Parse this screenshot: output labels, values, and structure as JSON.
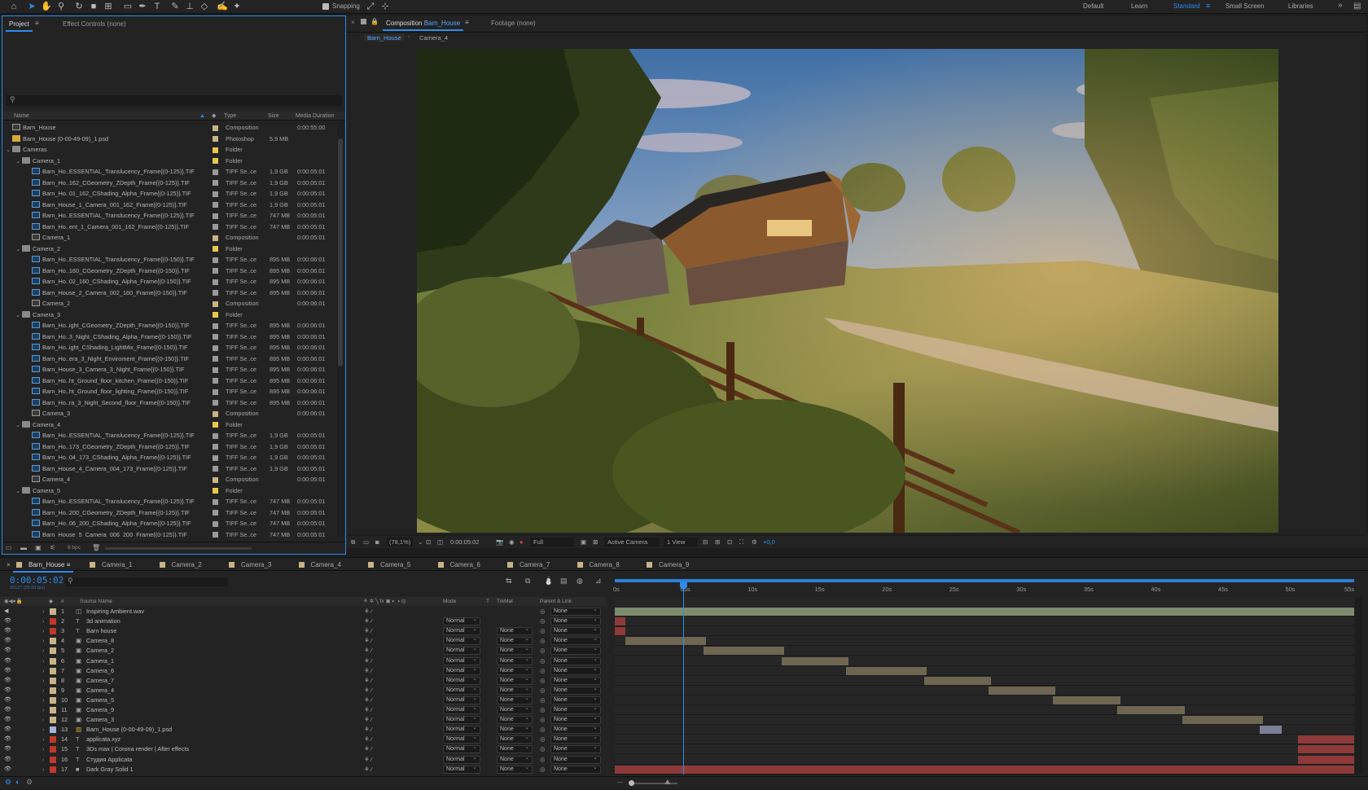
{
  "toolbar": {
    "snapping_label": "Snapping",
    "workspaces": [
      "Default",
      "Learn",
      "Standard",
      "Small Screen",
      "Libraries"
    ],
    "active_workspace": "Standard"
  },
  "project_panel": {
    "tab_project": "Project",
    "tab_effect_controls": "Effect Controls (none)",
    "columns": {
      "name": "Name",
      "type": "Type",
      "size": "Size",
      "duration": "Media Duration"
    },
    "bpc": "8 bpc",
    "items": [
      {
        "name": "Barn_House",
        "type": "Composition",
        "size": "",
        "dur": "0:00:55:00",
        "icon": "comp",
        "indent": 0,
        "tw": "",
        "color": "#c8b48a"
      },
      {
        "name": "Barn_House (0-00-49-09)_1.psd",
        "type": "Photoshop",
        "size": "5,9 MB",
        "dur": "",
        "icon": "psd",
        "indent": 0,
        "tw": "",
        "color": "#c8b48a"
      },
      {
        "name": "Cameras",
        "type": "Folder",
        "size": "",
        "dur": "",
        "icon": "folder",
        "indent": 0,
        "tw": "⌄",
        "color": "#e8c84a"
      },
      {
        "name": "Camera_1",
        "type": "Folder",
        "size": "",
        "dur": "",
        "icon": "folder",
        "indent": 1,
        "tw": "⌄",
        "color": "#e8c84a"
      },
      {
        "name": "Barn_Ho..ESSENTIAL_Translucency_Frame{(0-125)}.TIF",
        "type": "TIFF Se..ce",
        "size": "1,9 GB",
        "dur": "0:00:05:01",
        "icon": "tiff",
        "indent": 2,
        "tw": "",
        "color": "#9a9a9a"
      },
      {
        "name": "Barn_Ho..162_CGeometry_ZDepth_Frame{(0-125)}.TIF",
        "type": "TIFF Se..ce",
        "size": "1,9 GB",
        "dur": "0:00:05:01",
        "icon": "tiff",
        "indent": 2,
        "tw": "",
        "color": "#9a9a9a"
      },
      {
        "name": "Barn_Ho..01_162_CShading_Alpha_Frame{(0-125)}.TIF",
        "type": "TIFF Se..ce",
        "size": "1,9 GB",
        "dur": "0:00:05:01",
        "icon": "tiff",
        "indent": 2,
        "tw": "",
        "color": "#9a9a9a"
      },
      {
        "name": "Barn_House_1_Camera_001_162_Frame{(0-125)}.TIF",
        "type": "TIFF Se..ce",
        "size": "1,9 GB",
        "dur": "0:00:05:01",
        "icon": "tiff",
        "indent": 2,
        "tw": "",
        "color": "#9a9a9a"
      },
      {
        "name": "Barn_Ho..ESSENTIAL_Translucency_Frame{(0-125)}.TIF",
        "type": "TIFF Se..ce",
        "size": "747 MB",
        "dur": "0:00:05:01",
        "icon": "tiff",
        "indent": 2,
        "tw": "",
        "color": "#9a9a9a"
      },
      {
        "name": "Barn_Ho..ent_1_Camera_001_162_Frame{(0-125)}.TIF",
        "type": "TIFF Se..ce",
        "size": "747 MB",
        "dur": "0:00:05:01",
        "icon": "tiff",
        "indent": 2,
        "tw": "",
        "color": "#9a9a9a"
      },
      {
        "name": "Camera_1",
        "type": "Composition",
        "size": "",
        "dur": "0:00:05:01",
        "icon": "comp",
        "indent": 2,
        "tw": "",
        "color": "#c8b48a"
      },
      {
        "name": "Camera_2",
        "type": "Folder",
        "size": "",
        "dur": "",
        "icon": "folder",
        "indent": 1,
        "tw": "⌄",
        "color": "#e8c84a"
      },
      {
        "name": "Barn_Ho..ESSENTIAL_Translucency_Frame{(0-150)}.TIF",
        "type": "TIFF Se..ce",
        "size": "895 MB",
        "dur": "0:00:06:01",
        "icon": "tiff",
        "indent": 2,
        "tw": "",
        "color": "#9a9a9a"
      },
      {
        "name": "Barn_Ho..160_CGeometry_ZDepth_Frame{(0-150)}.TIF",
        "type": "TIFF Se..ce",
        "size": "895 MB",
        "dur": "0:00:06:01",
        "icon": "tiff",
        "indent": 2,
        "tw": "",
        "color": "#9a9a9a"
      },
      {
        "name": "Barn_Ho..02_160_CShading_Alpha_Frame{(0-150)}.TIF",
        "type": "TIFF Se..ce",
        "size": "895 MB",
        "dur": "0:00:06:01",
        "icon": "tiff",
        "indent": 2,
        "tw": "",
        "color": "#9a9a9a"
      },
      {
        "name": "Barn_House_2_Camera_002_160_Frame{(0-150)}.TIF",
        "type": "TIFF Se..ce",
        "size": "895 MB",
        "dur": "0:00:06:01",
        "icon": "tiff",
        "indent": 2,
        "tw": "",
        "color": "#9a9a9a"
      },
      {
        "name": "Camera_2",
        "type": "Composition",
        "size": "",
        "dur": "0:00:06:01",
        "icon": "comp",
        "indent": 2,
        "tw": "",
        "color": "#c8b48a"
      },
      {
        "name": "Camera_3",
        "type": "Folder",
        "size": "",
        "dur": "",
        "icon": "folder",
        "indent": 1,
        "tw": "⌄",
        "color": "#e8c84a"
      },
      {
        "name": "Barn_Ho..ight_CGeometry_ZDepth_Frame{(0-150)}.TIF",
        "type": "TIFF Se..ce",
        "size": "895 MB",
        "dur": "0:00:06:01",
        "icon": "tiff",
        "indent": 2,
        "tw": "",
        "color": "#9a9a9a"
      },
      {
        "name": "Barn_Ho..3_Night_CShading_Alpha_Frame{(0-150)}.TIF",
        "type": "TIFF Se..ce",
        "size": "895 MB",
        "dur": "0:00:06:01",
        "icon": "tiff",
        "indent": 2,
        "tw": "",
        "color": "#9a9a9a"
      },
      {
        "name": "Barn_Ho..ight_CShading_LightMix_Frame{(0-150)}.TIF",
        "type": "TIFF Se..ce",
        "size": "895 MB",
        "dur": "0:00:06:01",
        "icon": "tiff",
        "indent": 2,
        "tw": "",
        "color": "#9a9a9a"
      },
      {
        "name": "Barn_Ho..era_3_Night_Enviroment_Frame{(0-150)}.TIF",
        "type": "TIFF Se..ce",
        "size": "895 MB",
        "dur": "0:00:06:01",
        "icon": "tiff",
        "indent": 2,
        "tw": "",
        "color": "#9a9a9a"
      },
      {
        "name": "Barn_House_3_Camera_3_Night_Frame{(0-150)}.TIF",
        "type": "TIFF Se..ce",
        "size": "895 MB",
        "dur": "0:00:06:01",
        "icon": "tiff",
        "indent": 2,
        "tw": "",
        "color": "#9a9a9a"
      },
      {
        "name": "Barn_Ho..ht_Ground_floor_kitchen_Frame{(0-150)}.TIF",
        "type": "TIFF Se..ce",
        "size": "895 MB",
        "dur": "0:00:06:01",
        "icon": "tiff",
        "indent": 2,
        "tw": "",
        "color": "#9a9a9a"
      },
      {
        "name": "Barn_Ho..ht_Ground_floor_lighting_Frame{(0-150)}.TIF",
        "type": "TIFF Se..ce",
        "size": "895 MB",
        "dur": "0:00:06:01",
        "icon": "tiff",
        "indent": 2,
        "tw": "",
        "color": "#9a9a9a"
      },
      {
        "name": "Barn_Ho..ra_3_Night_Second_floor_Frame{(0-150)}.TIF",
        "type": "TIFF Se..ce",
        "size": "895 MB",
        "dur": "0:00:06:01",
        "icon": "tiff",
        "indent": 2,
        "tw": "",
        "color": "#9a9a9a"
      },
      {
        "name": "Camera_3",
        "type": "Composition",
        "size": "",
        "dur": "0:00:06:01",
        "icon": "comp",
        "indent": 2,
        "tw": "",
        "color": "#c8b48a"
      },
      {
        "name": "Camera_4",
        "type": "Folder",
        "size": "",
        "dur": "",
        "icon": "folder",
        "indent": 1,
        "tw": "⌄",
        "color": "#e8c84a"
      },
      {
        "name": "Barn_Ho..ESSENTIAL_Translucency_Frame{(0-125)}.TIF",
        "type": "TIFF Se..ce",
        "size": "1,9 GB",
        "dur": "0:00:05:01",
        "icon": "tiff",
        "indent": 2,
        "tw": "",
        "color": "#9a9a9a"
      },
      {
        "name": "Barn_Ho..173_CGeometry_ZDepth_Frame{(0-125)}.TIF",
        "type": "TIFF Se..ce",
        "size": "1,9 GB",
        "dur": "0:00:05:01",
        "icon": "tiff",
        "indent": 2,
        "tw": "",
        "color": "#9a9a9a"
      },
      {
        "name": "Barn_Ho..04_173_CShading_Alpha_Frame{(0-125)}.TIF",
        "type": "TIFF Se..ce",
        "size": "1,9 GB",
        "dur": "0:00:05:01",
        "icon": "tiff",
        "indent": 2,
        "tw": "",
        "color": "#9a9a9a"
      },
      {
        "name": "Barn_House_4_Camera_004_173_Frame{(0-125)}.TIF",
        "type": "TIFF Se..ce",
        "size": "1,9 GB",
        "dur": "0:00:05:01",
        "icon": "tiff",
        "indent": 2,
        "tw": "",
        "color": "#9a9a9a"
      },
      {
        "name": "Camera_4",
        "type": "Composition",
        "size": "",
        "dur": "0:00:05:01",
        "icon": "comp",
        "indent": 2,
        "tw": "",
        "color": "#c8b48a"
      },
      {
        "name": "Camera_5",
        "type": "Folder",
        "size": "",
        "dur": "",
        "icon": "folder",
        "indent": 1,
        "tw": "⌄",
        "color": "#e8c84a"
      },
      {
        "name": "Barn_Ho..ESSENTIAL_Translucency_Frame{(0-125)}.TIF",
        "type": "TIFF Se..ce",
        "size": "747 MB",
        "dur": "0:00:05:01",
        "icon": "tiff",
        "indent": 2,
        "tw": "",
        "color": "#9a9a9a"
      },
      {
        "name": "Barn_Ho..200_CGeometry_ZDepth_Frame{(0-125)}.TIF",
        "type": "TIFF Se..ce",
        "size": "747 MB",
        "dur": "0:00:05:01",
        "icon": "tiff",
        "indent": 2,
        "tw": "",
        "color": "#9a9a9a"
      },
      {
        "name": "Barn_Ho..06_200_CShading_Alpha_Frame{(0-125)}.TIF",
        "type": "TIFF Se..ce",
        "size": "747 MB",
        "dur": "0:00:05:01",
        "icon": "tiff",
        "indent": 2,
        "tw": "",
        "color": "#9a9a9a"
      },
      {
        "name": "Barn_House_5_Camera_006_200_Frame{(0-125)}.TIF",
        "type": "TIFF Se..ce",
        "size": "747 MB",
        "dur": "0:00:05:01",
        "icon": "tiff",
        "indent": 2,
        "tw": "",
        "color": "#9a9a9a"
      }
    ]
  },
  "composition_panel": {
    "tab_label": "Composition",
    "comp_name": "Barn_House",
    "tab_footage": "Footage (none)",
    "breadcrumb": [
      "Barn_House",
      "Camera_4"
    ],
    "zoom": "(78,1%)",
    "timecode": "0:00:05:02",
    "resolution": "Full",
    "camera": "Active Camera",
    "views": "1 View",
    "exposure": "+0,0"
  },
  "timeline": {
    "tabs": [
      "Barn_House",
      "Camera_1",
      "Camera_2",
      "Camera_3",
      "Camera_4",
      "Camera_5",
      "Camera_6",
      "Camera_7",
      "Camera_8",
      "Camera_9"
    ],
    "timecode": "0:00:05:02",
    "frame_info": "00127 (25.00 fps)",
    "columns": {
      "num": "#",
      "source": "Source Name",
      "mode": "Mode",
      "t": "T",
      "trkmat": "TrkMat",
      "parent": "Parent & Link"
    },
    "ruler": [
      "0s",
      "05s",
      "10s",
      "15s",
      "20s",
      "25s",
      "30s",
      "35s",
      "40s",
      "45s",
      "50s",
      "55s"
    ],
    "duration_seconds": 55,
    "playhead_seconds": 5.08,
    "layers": [
      {
        "num": "1",
        "name": "Inspiring Ambient.wav",
        "type": "audio",
        "label": "#c8b48a",
        "mode": "",
        "trk": "",
        "parent": "None",
        "bar": [
          0,
          55
        ],
        "barColor": "#7d8c6e"
      },
      {
        "num": "2",
        "name": "3d animation",
        "type": "text",
        "label": "#c0392b",
        "mode": "Normal",
        "trk": "",
        "parent": "None",
        "bar": [
          0,
          0.8
        ],
        "barColor": "#8e3a3a"
      },
      {
        "num": "3",
        "name": "Barn house",
        "type": "text",
        "label": "#c0392b",
        "mode": "Normal",
        "trk": "None",
        "parent": "None",
        "bar": [
          0,
          0.8
        ],
        "barColor": "#8e3a3a"
      },
      {
        "num": "4",
        "name": "Camera_8",
        "type": "comp",
        "label": "#c8b48a",
        "mode": "Normal",
        "trk": "None",
        "parent": "None",
        "bar": [
          0.8,
          6.8
        ],
        "barColor": "#6e6652"
      },
      {
        "num": "5",
        "name": "Camera_2",
        "type": "comp",
        "label": "#c8b48a",
        "mode": "Normal",
        "trk": "None",
        "parent": "None",
        "bar": [
          6.6,
          12.6
        ],
        "barColor": "#6e6652"
      },
      {
        "num": "6",
        "name": "Camera_1",
        "type": "comp",
        "label": "#c8b48a",
        "mode": "Normal",
        "trk": "None",
        "parent": "None",
        "bar": [
          12.4,
          17.4
        ],
        "barColor": "#6e6652"
      },
      {
        "num": "7",
        "name": "Camera_6",
        "type": "comp",
        "label": "#c8b48a",
        "mode": "Normal",
        "trk": "None",
        "parent": "None",
        "bar": [
          17.2,
          23.2
        ],
        "barColor": "#6e6652"
      },
      {
        "num": "8",
        "name": "Camera_7",
        "type": "comp",
        "label": "#c8b48a",
        "mode": "Normal",
        "trk": "None",
        "parent": "None",
        "bar": [
          23.0,
          28.0
        ],
        "barColor": "#6e6652"
      },
      {
        "num": "9",
        "name": "Camera_4",
        "type": "comp",
        "label": "#c8b48a",
        "mode": "Normal",
        "trk": "None",
        "parent": "None",
        "bar": [
          27.8,
          32.8
        ],
        "barColor": "#6e6652"
      },
      {
        "num": "10",
        "name": "Camera_5",
        "type": "comp",
        "label": "#c8b48a",
        "mode": "Normal",
        "trk": "None",
        "parent": "None",
        "bar": [
          32.6,
          37.6
        ],
        "barColor": "#6e6652"
      },
      {
        "num": "11",
        "name": "Camera_9",
        "type": "comp",
        "label": "#c8b48a",
        "mode": "Normal",
        "trk": "None",
        "parent": "None",
        "bar": [
          37.4,
          42.4
        ],
        "barColor": "#6e6652"
      },
      {
        "num": "12",
        "name": "Camera_3",
        "type": "comp",
        "label": "#c8b48a",
        "mode": "Normal",
        "trk": "None",
        "parent": "None",
        "bar": [
          42.2,
          48.2
        ],
        "barColor": "#6e6652"
      },
      {
        "num": "13",
        "name": "Barn_House (0-00-49-09)_1.psd",
        "type": "psd",
        "label": "#a4b4d8",
        "mode": "Normal",
        "trk": "None",
        "parent": "None",
        "bar": [
          48.0,
          49.6
        ],
        "barColor": "#7b7f95"
      },
      {
        "num": "14",
        "name": "applicata.xyz",
        "type": "text",
        "label": "#c0392b",
        "mode": "Normal",
        "trk": "None",
        "parent": "None",
        "bar": [
          50.8,
          55
        ],
        "barColor": "#8e3a3a"
      },
      {
        "num": "15",
        "name": "3Ds max | Corona render | After effects",
        "type": "text",
        "label": "#c0392b",
        "mode": "Normal",
        "trk": "None",
        "parent": "None",
        "bar": [
          50.8,
          55
        ],
        "barColor": "#8e3a3a"
      },
      {
        "num": "16",
        "name": "Студия Applicata",
        "type": "text",
        "label": "#c0392b",
        "mode": "Normal",
        "trk": "None",
        "parent": "None",
        "bar": [
          50.8,
          55
        ],
        "barColor": "#8e3a3a"
      },
      {
        "num": "17",
        "name": "Dark Gray Solid 1",
        "type": "solid",
        "label": "#c0392b",
        "mode": "Normal",
        "trk": "None",
        "parent": "None",
        "bar": [
          0,
          55
        ],
        "barColor": "#8e3a3a"
      }
    ]
  },
  "colors": {
    "accent": "#2d8ceb",
    "panel": "#232323",
    "bg": "#1d1d1d"
  }
}
